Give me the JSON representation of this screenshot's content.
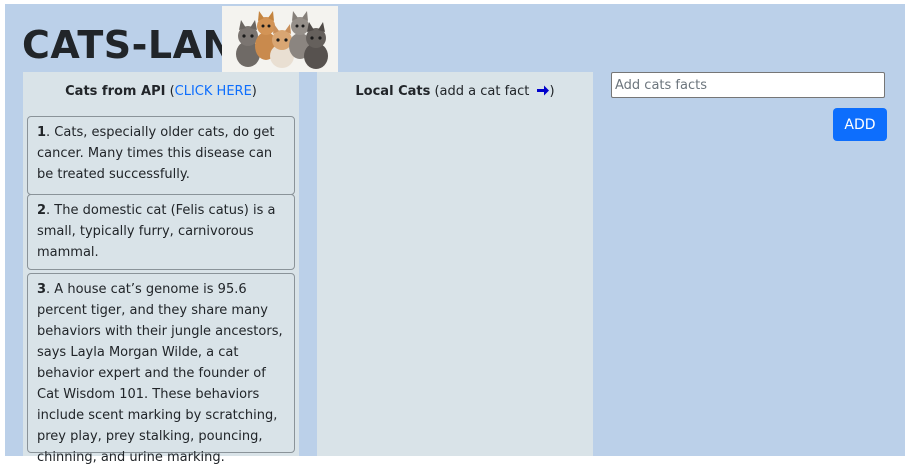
{
  "header": {
    "title": "CATS-LAND",
    "logo_icon": "kittens-photo"
  },
  "api_column": {
    "title": "Cats from API",
    "open_paren": " (",
    "link_label": "CLICK HERE",
    "close_paren": ")",
    "facts": [
      {
        "number": "1",
        "text": ". Cats, especially older cats, do get cancer. Many times this disease can be treated successfully."
      },
      {
        "number": "2",
        "text": ". The domestic cat (Felis catus) is a small, typically furry, carnivorous mammal."
      },
      {
        "number": "3",
        "text": ". A house cat’s genome is 95.6 percent tiger, and they share many behaviors with their jungle ancestors, says Layla Morgan Wilde, a cat behavior expert and the founder of Cat Wisdom 101. These behaviors include scent marking by scratching, prey play, prey stalking, pouncing, chinning, and urine marking."
      }
    ]
  },
  "local_column": {
    "title": "Local Cats",
    "hint": " (add a cat fact ",
    "hint_close": ")",
    "arrow_icon": "arrow-right-icon"
  },
  "form": {
    "placeholder": "Add cats facts",
    "value": "",
    "add_label": "ADD"
  },
  "colors": {
    "background": "#bbd0e9",
    "panel": "#d9e3e8",
    "accent": "#0d6efd",
    "arrow": "#0000cc"
  }
}
